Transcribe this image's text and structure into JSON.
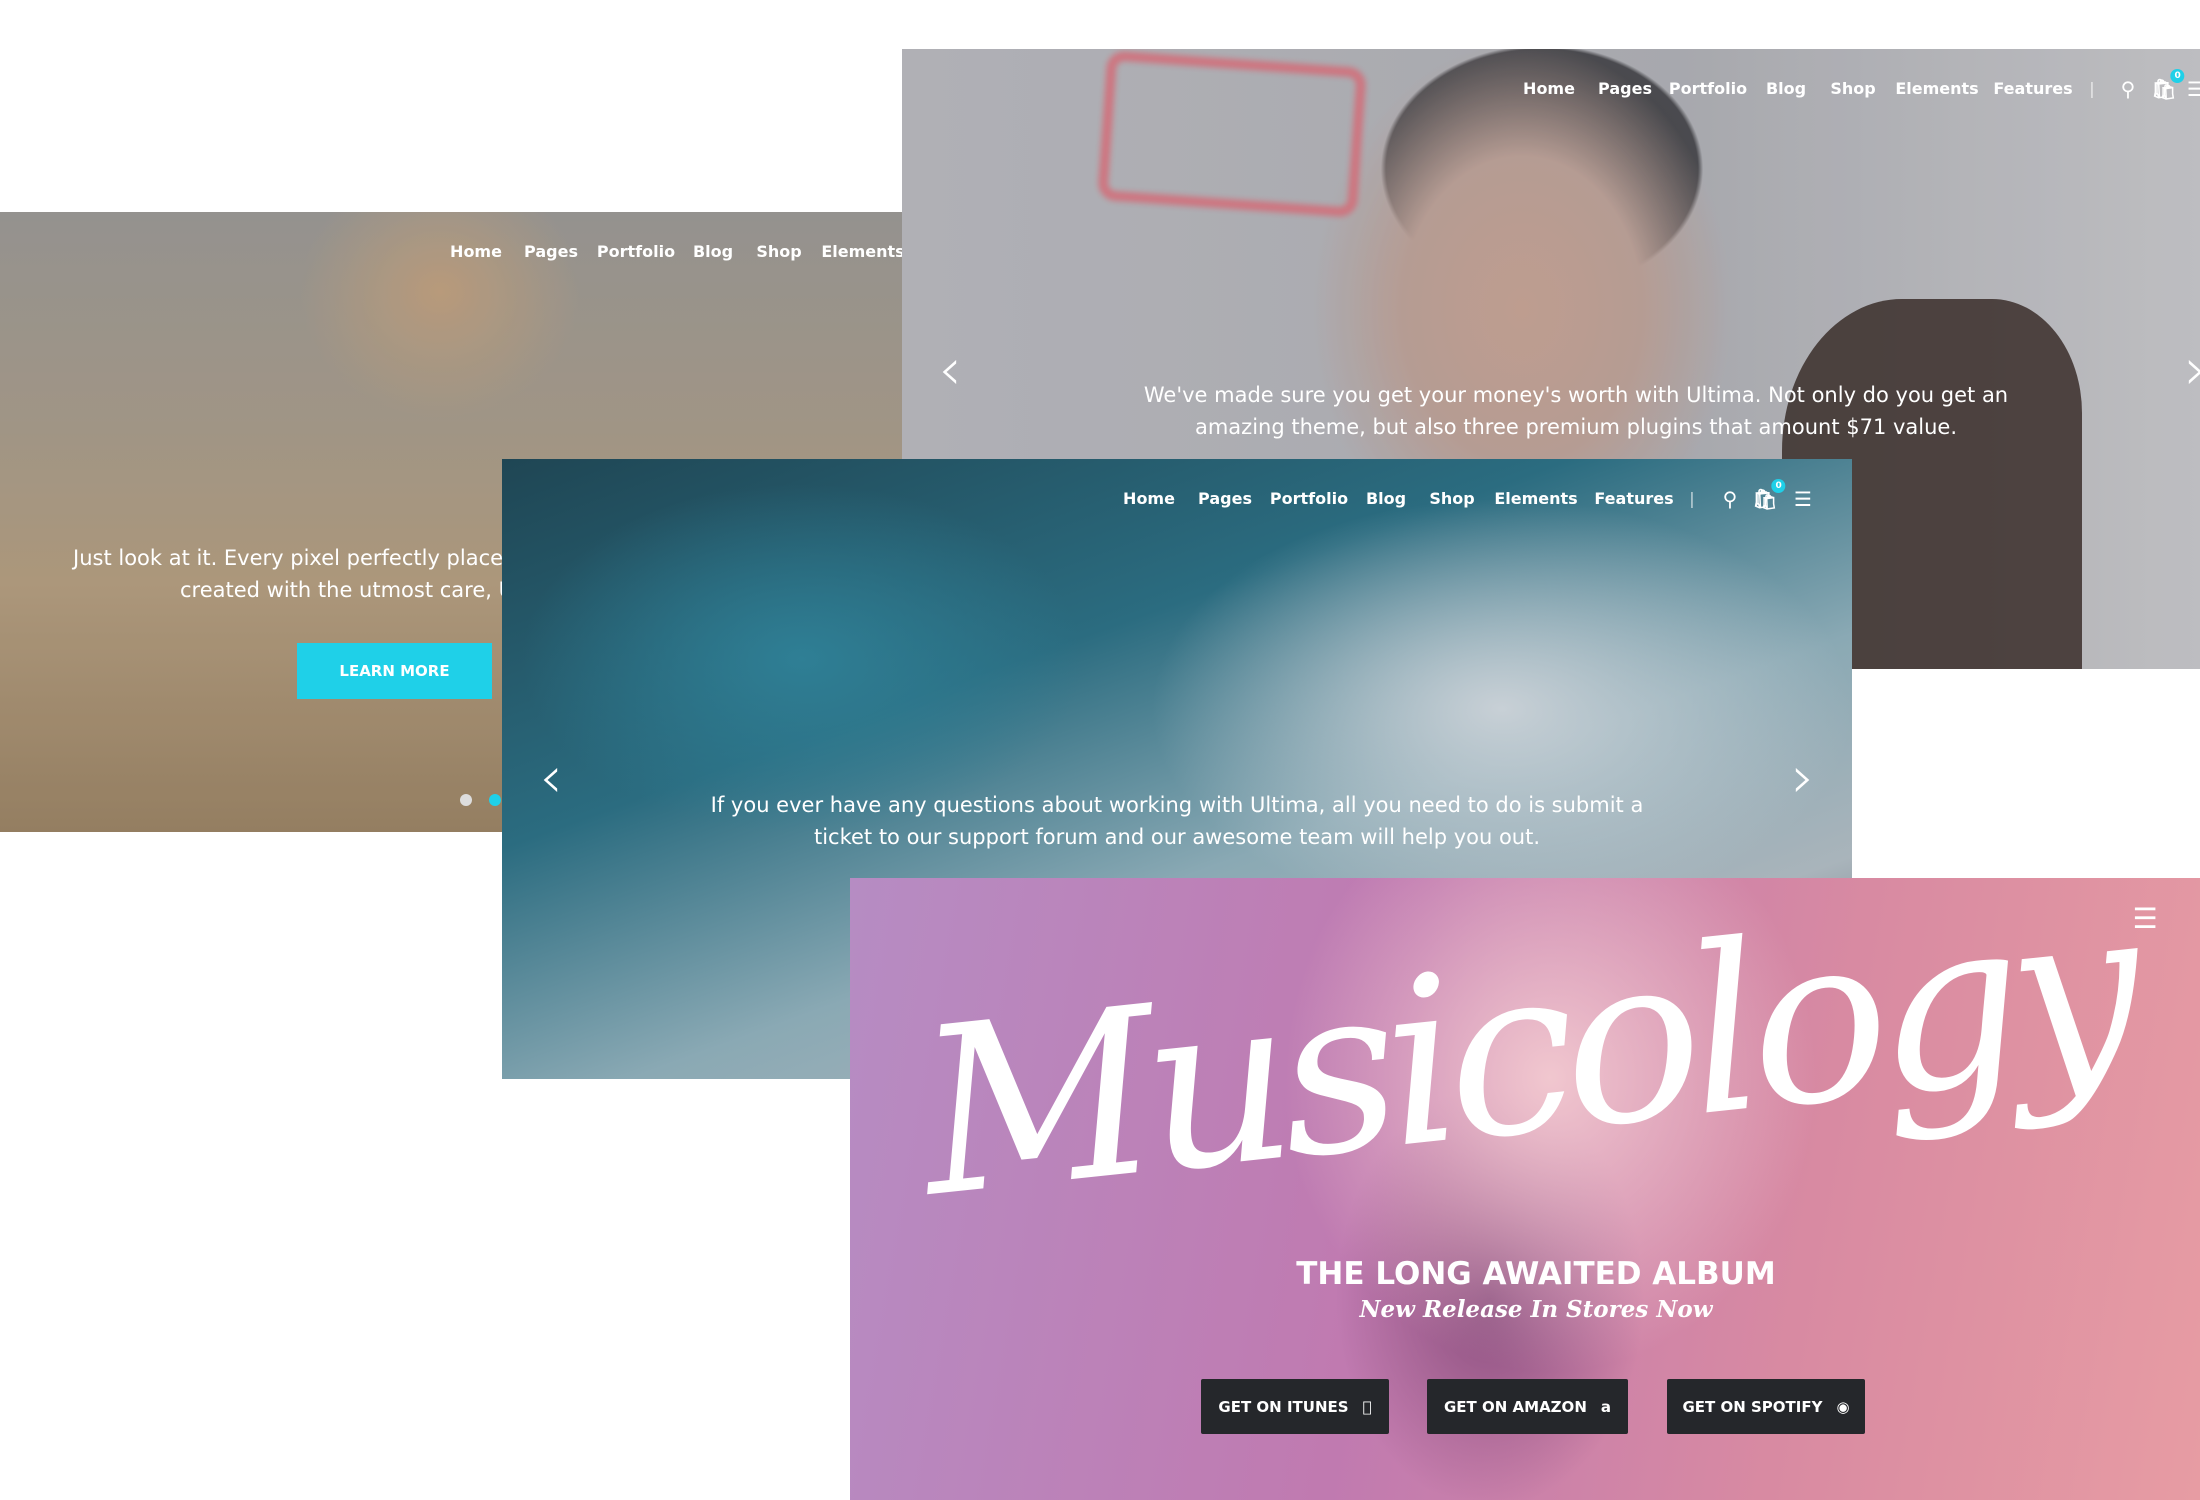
{
  "top_slide": {
    "nav": [
      "Home",
      "Pages",
      "Portfolio",
      "Blog",
      "Shop",
      "Elements",
      "Features"
    ],
    "cart_count": "0",
    "caption": [
      "We've made sure you get your money's worth with Ultima. Not only do you get an",
      "amazing theme, but also three premium plugins that amount $71 value."
    ]
  },
  "beach_slide": {
    "nav": [
      "Home",
      "Pages",
      "Portfolio",
      "Blog",
      "Shop",
      "Elements"
    ],
    "caption": [
      "Just look at it. Every pixel perfectly placed, ev",
      "created with the utmost care, Ulti"
    ],
    "button": "LEARN MORE"
  },
  "ice_slide": {
    "nav": [
      "Home",
      "Pages",
      "Portfolio",
      "Blog",
      "Shop",
      "Elements",
      "Features"
    ],
    "cart_count": "0",
    "caption": [
      "If you ever have any questions about working with Ultima, all you need to do is submit a",
      "ticket to our support forum and our awesome team will help you out."
    ]
  },
  "music_slide": {
    "logo": "Musicology",
    "headline": "THE LONG AWAITED ALBUM",
    "subheadline": "New Release In Stores Now",
    "buttons": [
      {
        "label": "GET ON ITUNES",
        "icon": "apple-icon"
      },
      {
        "label": "GET ON AMAZON",
        "icon": "amazon-icon"
      },
      {
        "label": "GET ON SPOTIFY",
        "icon": "spotify-icon"
      }
    ]
  },
  "colors": {
    "accent": "#1fd0e8",
    "button_dark": "#25272b"
  }
}
